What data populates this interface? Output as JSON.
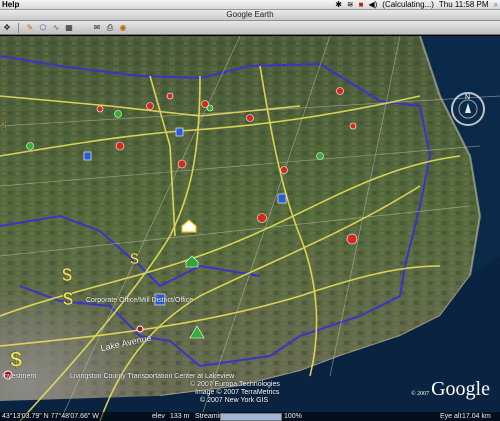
{
  "menubar": {
    "app_menu": "Help",
    "status_text": "(Calculating...)",
    "clock": "Thu 11:58 PM"
  },
  "window": {
    "title": "Google Earth"
  },
  "toolbar": {
    "buttons": [
      "hand",
      "placemark",
      "polygon",
      "path",
      "overlay",
      "email",
      "print",
      "google-maps"
    ]
  },
  "map": {
    "labels": {
      "street": "Lake Avenue",
      "overlay1": "Livingston County Transportation Center at Lakeview",
      "overlay2": "Investment",
      "overlay3": "Corporate Office/Mill District/Office",
      "copyright1": "© 2007 Europa Technologies",
      "copyright2": "Image © 2007 TerraMetrics",
      "copyright3": "© 2007 New York GIS",
      "year_small": "© 2007"
    },
    "watermark": "Google",
    "colors": {
      "border": "#3b33c8",
      "road": "#e9df58",
      "water": "#0b2a4a"
    }
  },
  "statusbar": {
    "pointer": "43°13'03.79\" N  77°48'07.66\" W",
    "elev_label": "elev",
    "elev_value": "133 m",
    "streaming_label": "Streaming",
    "streaming_pct": "100%",
    "streaming_fraction": 1.0,
    "eye_alt_label": "Eye alt",
    "eye_alt_value": "17.04 km"
  }
}
